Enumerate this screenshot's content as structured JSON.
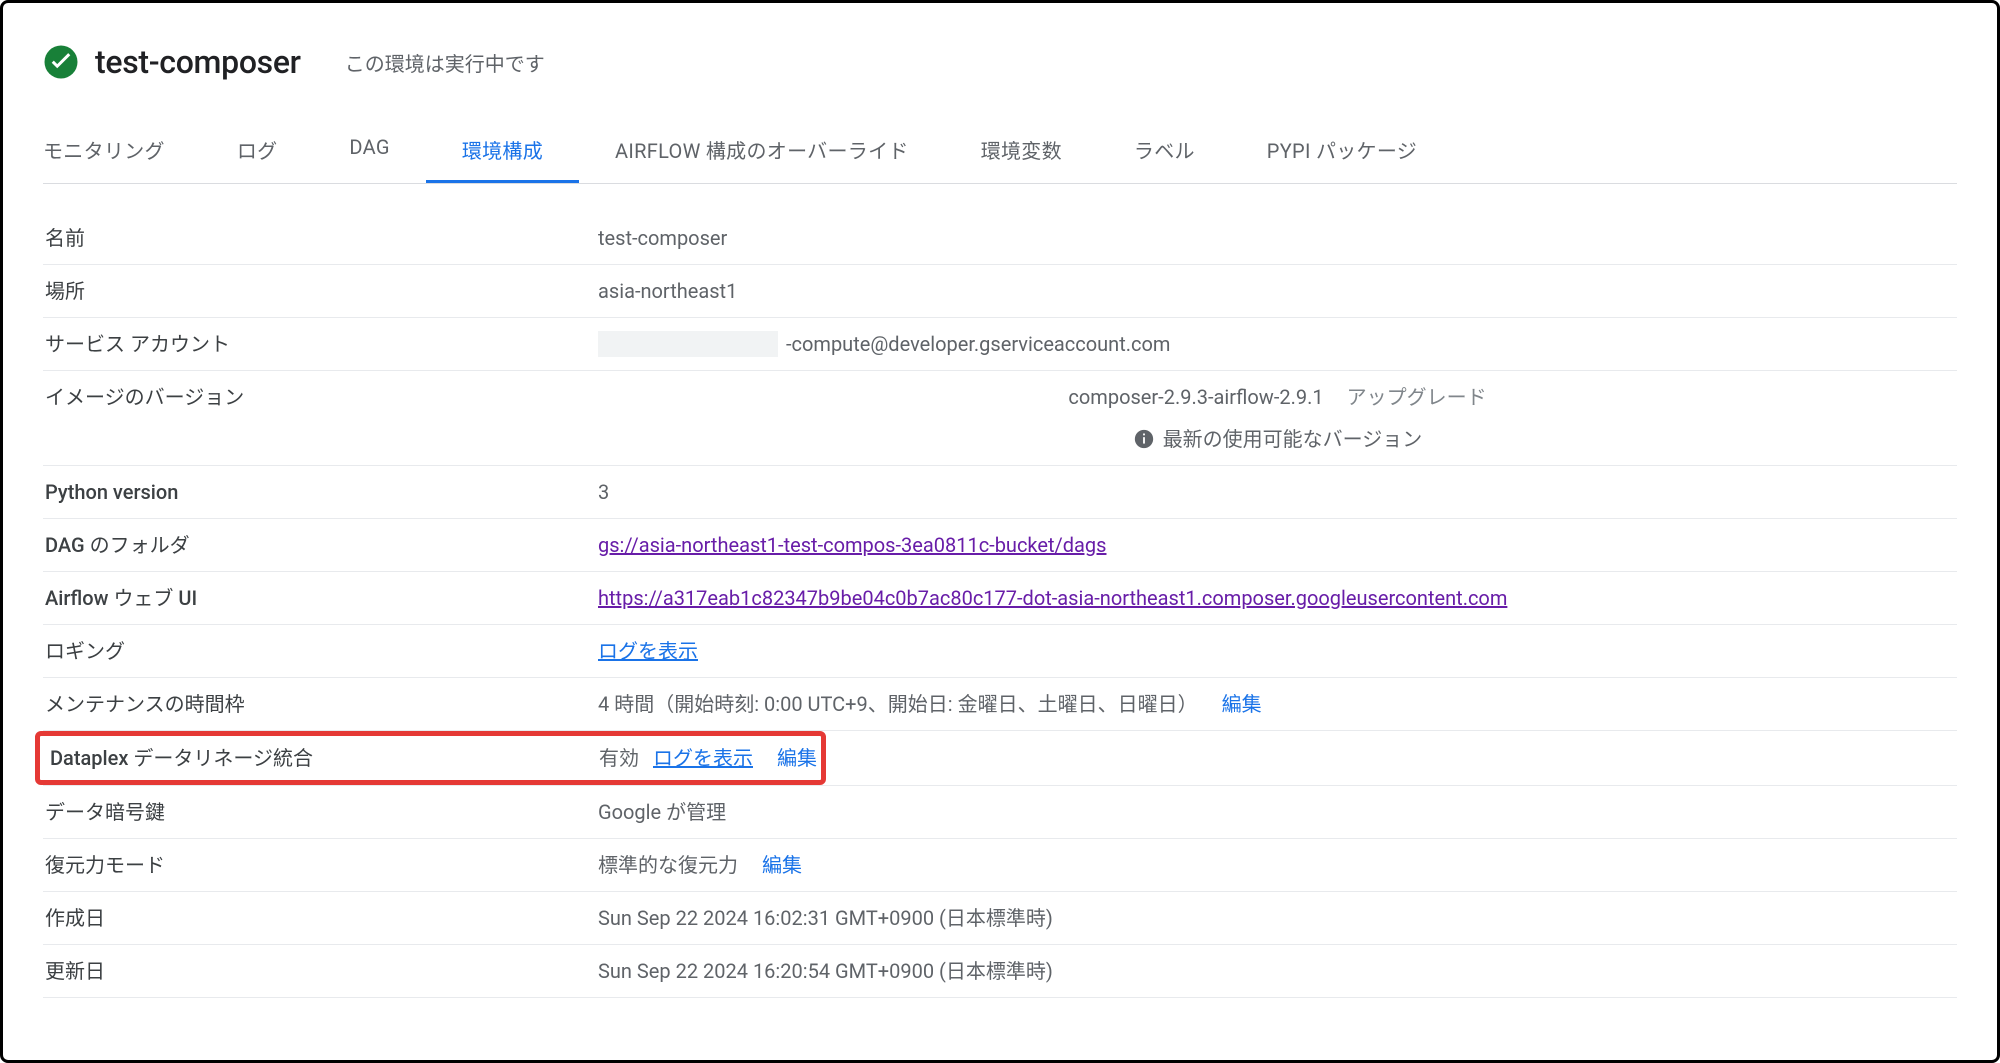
{
  "header": {
    "title": "test-composer",
    "status": "この環境は実行中です"
  },
  "tabs": [
    {
      "label": "モニタリング",
      "active": false
    },
    {
      "label": "ログ",
      "active": false
    },
    {
      "label": "DAG",
      "active": false
    },
    {
      "label": "環境構成",
      "active": true
    },
    {
      "label": "AIRFLOW 構成のオーバーライド",
      "active": false
    },
    {
      "label": "環境変数",
      "active": false
    },
    {
      "label": "ラベル",
      "active": false
    },
    {
      "label": "PYPI パッケージ",
      "active": false
    }
  ],
  "config": {
    "name": {
      "label": "名前",
      "value": "test-composer"
    },
    "location": {
      "label": "場所",
      "value": "asia-northeast1"
    },
    "service_account": {
      "label": "サービス アカウント",
      "value_suffix": "-compute@developer.gserviceaccount.com"
    },
    "image_version": {
      "label": "イメージのバージョン",
      "value": "composer-2.9.3-airflow-2.9.1",
      "upgrade": "アップグレード",
      "info": "最新の使用可能なバージョン"
    },
    "python_version": {
      "label": "Python version",
      "value": "3"
    },
    "dag_folder": {
      "label": "DAG のフォルダ",
      "value": "gs://asia-northeast1-test-compos-3ea0811c-bucket/dags"
    },
    "airflow_ui": {
      "label": "Airflow ウェブ UI",
      "value": "https://a317eab1c82347b9be04c0b7ac80c177-dot-asia-northeast1.composer.googleusercontent.com"
    },
    "logging": {
      "label": "ロギング",
      "link": "ログを表示"
    },
    "maintenance": {
      "label": "メンテナンスの時間枠",
      "value": "4 時間（開始時刻: 0:00 UTC+9、開始日: 金曜日、土曜日、日曜日）",
      "edit": "編集"
    },
    "dataplex": {
      "label": "Dataplex データリネージ統合",
      "status": "有効",
      "show_logs": "ログを表示",
      "edit": "編集"
    },
    "encryption": {
      "label": "データ暗号鍵",
      "value": "Google が管理"
    },
    "resilience": {
      "label": "復元力モード",
      "value": "標準的な復元力",
      "edit": "編集"
    },
    "created": {
      "label": "作成日",
      "value": "Sun Sep 22 2024 16:02:31 GMT+0900 (日本標準時)"
    },
    "updated": {
      "label": "更新日",
      "value": "Sun Sep 22 2024 16:20:54 GMT+0900 (日本標準時)"
    }
  }
}
